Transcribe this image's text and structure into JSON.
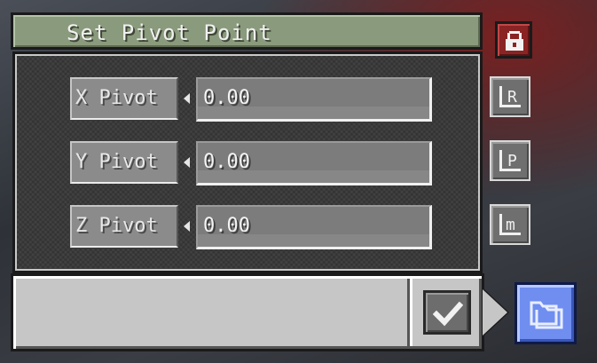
{
  "dialog": {
    "title": "Set Pivot Point",
    "rows": [
      {
        "label": "X Pivot",
        "value": "0.00"
      },
      {
        "label": "Y Pivot",
        "value": "0.00"
      },
      {
        "label": "Z Pivot",
        "value": "0.00"
      }
    ]
  },
  "side_buttons": [
    {
      "icon": "pivot-reset-icon",
      "glyph": "R"
    },
    {
      "icon": "pivot-position-icon",
      "glyph": "P"
    },
    {
      "icon": "pivot-model-icon",
      "glyph": "m"
    }
  ],
  "icons": {
    "lock": "lock-icon",
    "confirm": "checkmark-icon",
    "folder": "folder-icon"
  },
  "colors": {
    "title_bg": "#8a9a7c",
    "lock_bg": "#8a2424",
    "folder_bg": "#6f8ef0",
    "panel_bg": "#3a3a3a",
    "bottom_bg": "#c6c6c6"
  }
}
